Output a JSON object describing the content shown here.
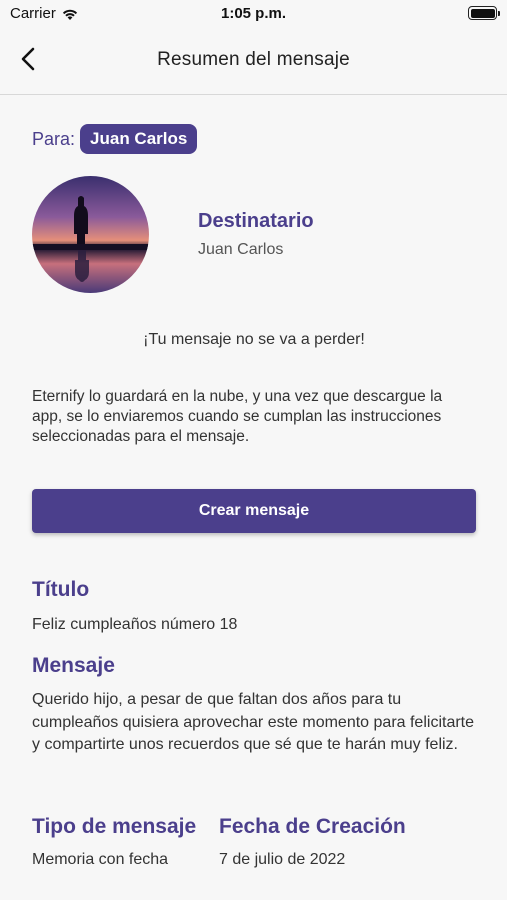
{
  "status_bar": {
    "carrier": "Carrier",
    "time": "1:05 p.m."
  },
  "nav": {
    "title": "Resumen del mensaje",
    "back_icon": "chevron-left-icon"
  },
  "recipient": {
    "to_label": "Para:",
    "to_name": "Juan Carlos",
    "heading": "Destinatario",
    "name": "Juan Carlos"
  },
  "notice": "¡Tu mensaje no se va a perder!",
  "description": "Eternify lo guardará en la nube, y una vez que descargue la app, se lo enviaremos cuando se cumplan las instrucciones seleccionadas para el mensaje.",
  "create_button": "Crear mensaje",
  "details": {
    "title_label": "Título",
    "title_value": "Feliz cumpleaños número 18",
    "message_label": "Mensaje",
    "message_value": "Querido hijo, a pesar de que faltan dos años para tu cumpleaños quisiera aprovechar este momento para felicitarte y compartirte unos recuerdos que sé que te harán muy feliz.",
    "type_label": "Tipo de mensaje",
    "type_value": "Memoria con fecha",
    "date_label": "Fecha de Creación",
    "date_value": "7 de julio de 2022"
  },
  "colors": {
    "accent": "#4b3f8c",
    "background": "#f7f7f7"
  }
}
